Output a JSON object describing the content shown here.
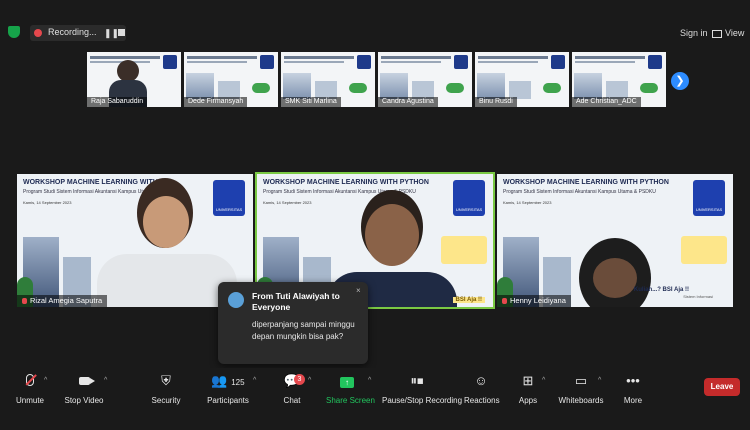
{
  "topbar": {
    "recording_label": "Recording...",
    "sign_in": "Sign in",
    "view": "View",
    "pause_glyph": "❚❚"
  },
  "thumbnails": [
    {
      "name": "Raja Sabaruddin"
    },
    {
      "name": "Dede Firmansyah"
    },
    {
      "name": "SMK Siti Marlina"
    },
    {
      "name": "Candra Agustina"
    },
    {
      "name": "Binu Rusdi"
    },
    {
      "name": "Ade Christian_ADC"
    }
  ],
  "next_arrow": "❯",
  "tiles": [
    {
      "title": "WORKSHOP MACHINE LEARNING WITH",
      "subtitle": "Program Studi Sistem Informasi Akuntansi Kampus Utama & PSDKU",
      "date": "Kamis, 14 September 2023",
      "name": "Rizal Amegia Saputra"
    },
    {
      "title": "WORKSHOP MACHINE LEARNING WITH PYTHON",
      "subtitle": "Program Studi Sistem Informasi Akuntansi Kampus Utama & PSDKU",
      "date": "Kamis, 14 September 2023",
      "name": "",
      "banner": "BSI Aja !!"
    },
    {
      "title": "WORKSHOP MACHINE LEARNING WITH PYTHON",
      "subtitle": "Program Studi Sistem Informasi Akuntansi Kampus Utama & PSDKU",
      "date": "Kamis, 14 September 2023",
      "name": "Henny Leidiyana",
      "kuliah": "Kuliah...? BSI Aja !!",
      "kuliah_sub": "Sistem Informasi"
    }
  ],
  "badge_text": "UNIVERSITAS",
  "chat_popup": {
    "title": "From Tuti Alawiyah to Everyone",
    "message": "diperpanjang sampai minggu depan mungkin bisa pak?",
    "close": "×"
  },
  "toolbar": {
    "unmute": "Unmute",
    "stop_video": "Stop Video",
    "security": "Security",
    "participants": "Participants",
    "participants_count": "125",
    "chat": "Chat",
    "chat_badge": "3",
    "share_screen": "Share Screen",
    "pause_stop_recording": "Pause/Stop Recording",
    "reactions": "Reactions",
    "apps": "Apps",
    "whiteboards": "Whiteboards",
    "more": "More",
    "leave": "Leave",
    "caret": "^"
  },
  "colors": {
    "background": "#1a1a1a",
    "leave": "#c42b2b",
    "share": "#22c55e",
    "accent": "#2d8cff",
    "active_speaker": "#7ac943"
  }
}
